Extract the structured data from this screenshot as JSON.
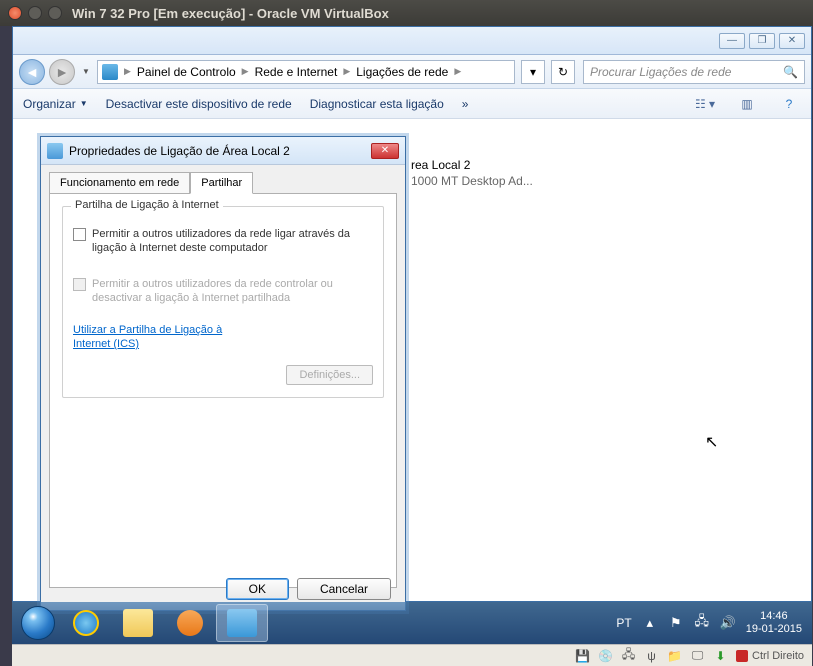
{
  "ubuntu": {
    "title": "Win 7 32 Pro [Em execução] - Oracle VM VirtualBox"
  },
  "breadcrumb": {
    "c1": "Painel de Controlo",
    "c2": "Rede e Internet",
    "c3": "Ligações de rede"
  },
  "search": {
    "placeholder": "Procurar Ligações de rede"
  },
  "toolbar": {
    "organize": "Organizar",
    "disable": "Desactivar este dispositivo de rede",
    "diagnose": "Diagnosticar esta ligação",
    "more": "»"
  },
  "netitem": {
    "name": "rea Local 2",
    "device": "1000 MT Desktop Ad..."
  },
  "dialog": {
    "title": "Propriedades de Ligação de Área Local 2",
    "tab1": "Funcionamento em rede",
    "tab2": "Partilhar",
    "group_legend": "Partilha de Ligação à Internet",
    "chk1": "Permitir a outros utilizadores da rede ligar através da ligação à Internet deste computador",
    "chk2": "Permitir a outros utilizadores da rede controlar ou desactivar a ligação à Internet partilhada",
    "link": "Utilizar a Partilha de Ligação à Internet (ICS)",
    "definitions": "Definições...",
    "ok": "OK",
    "cancel": "Cancelar"
  },
  "tray": {
    "lang": "PT",
    "time": "14:46",
    "date": "19-01-2015"
  },
  "vbox": {
    "hostkey": "Ctrl Direito"
  }
}
